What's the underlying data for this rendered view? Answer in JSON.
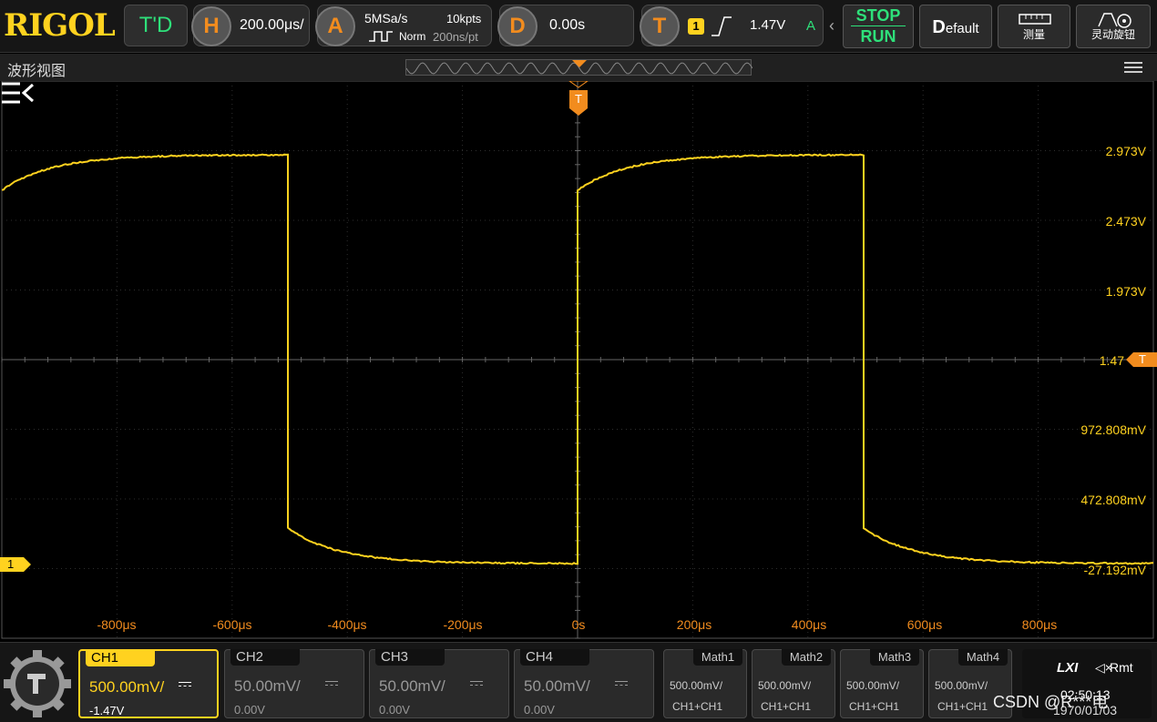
{
  "topbar": {
    "logo": "RIGOL",
    "td_label": "T'D",
    "horizontal": {
      "badge": "H",
      "timebase": "200.00μs/"
    },
    "acquire": {
      "badge": "A",
      "sample_rate": "5MSa/s",
      "memory_depth": "10kpts",
      "mode": "Norm",
      "resolution": "200ns/pt"
    },
    "delay": {
      "badge": "D",
      "value": "0.00s"
    },
    "trigger": {
      "badge": "T",
      "source": "1",
      "level": "1.47V",
      "sweep": "A"
    },
    "stop_label": "STOP",
    "run_label": "RUN",
    "default_label": "efault",
    "default_initial": "D",
    "measure_label": "测量",
    "flex_knob_label": "灵动旋钮"
  },
  "view": {
    "title": "波形视图"
  },
  "scope": {
    "trigger_marker": "T",
    "channel_marker": "1",
    "trigger_level_marker": "T",
    "voltage_labels": [
      "2.973V",
      "2.473V",
      "1.973V",
      "1.47",
      "972.808mV",
      "472.808mV",
      "-27.192mV"
    ],
    "time_labels": [
      "-800μs",
      "-600μs",
      "-400μs",
      "-200μs",
      "0s",
      "200μs",
      "400μs",
      "600μs",
      "800μs"
    ],
    "trace_color": "#ffd21f",
    "accent_color": "#f28c1e"
  },
  "channels": [
    {
      "name": "CH1",
      "scale": "500.00mV/",
      "offset": "-1.47V",
      "active": true
    },
    {
      "name": "CH2",
      "scale": "50.00mV/",
      "offset": "0.00V",
      "active": false
    },
    {
      "name": "CH3",
      "scale": "50.00mV/",
      "offset": "0.00V",
      "active": false
    },
    {
      "name": "CH4",
      "scale": "50.00mV/",
      "offset": "0.00V",
      "active": false
    }
  ],
  "math": [
    {
      "name": "Math1",
      "scale": "500.00mV/",
      "source": "CH1+CH1"
    },
    {
      "name": "Math2",
      "scale": "500.00mV/",
      "source": "CH1+CH1"
    },
    {
      "name": "Math3",
      "scale": "500.00mV/",
      "source": "CH1+CH1"
    },
    {
      "name": "Math4",
      "scale": "500.00mV/",
      "source": "CH1+CH1"
    }
  ],
  "status": {
    "lxi": "LXI",
    "remote": "Rmt",
    "time": "02:50:13",
    "date": "1970/01/03"
  },
  "watermark": "CSDN @R***电"
}
